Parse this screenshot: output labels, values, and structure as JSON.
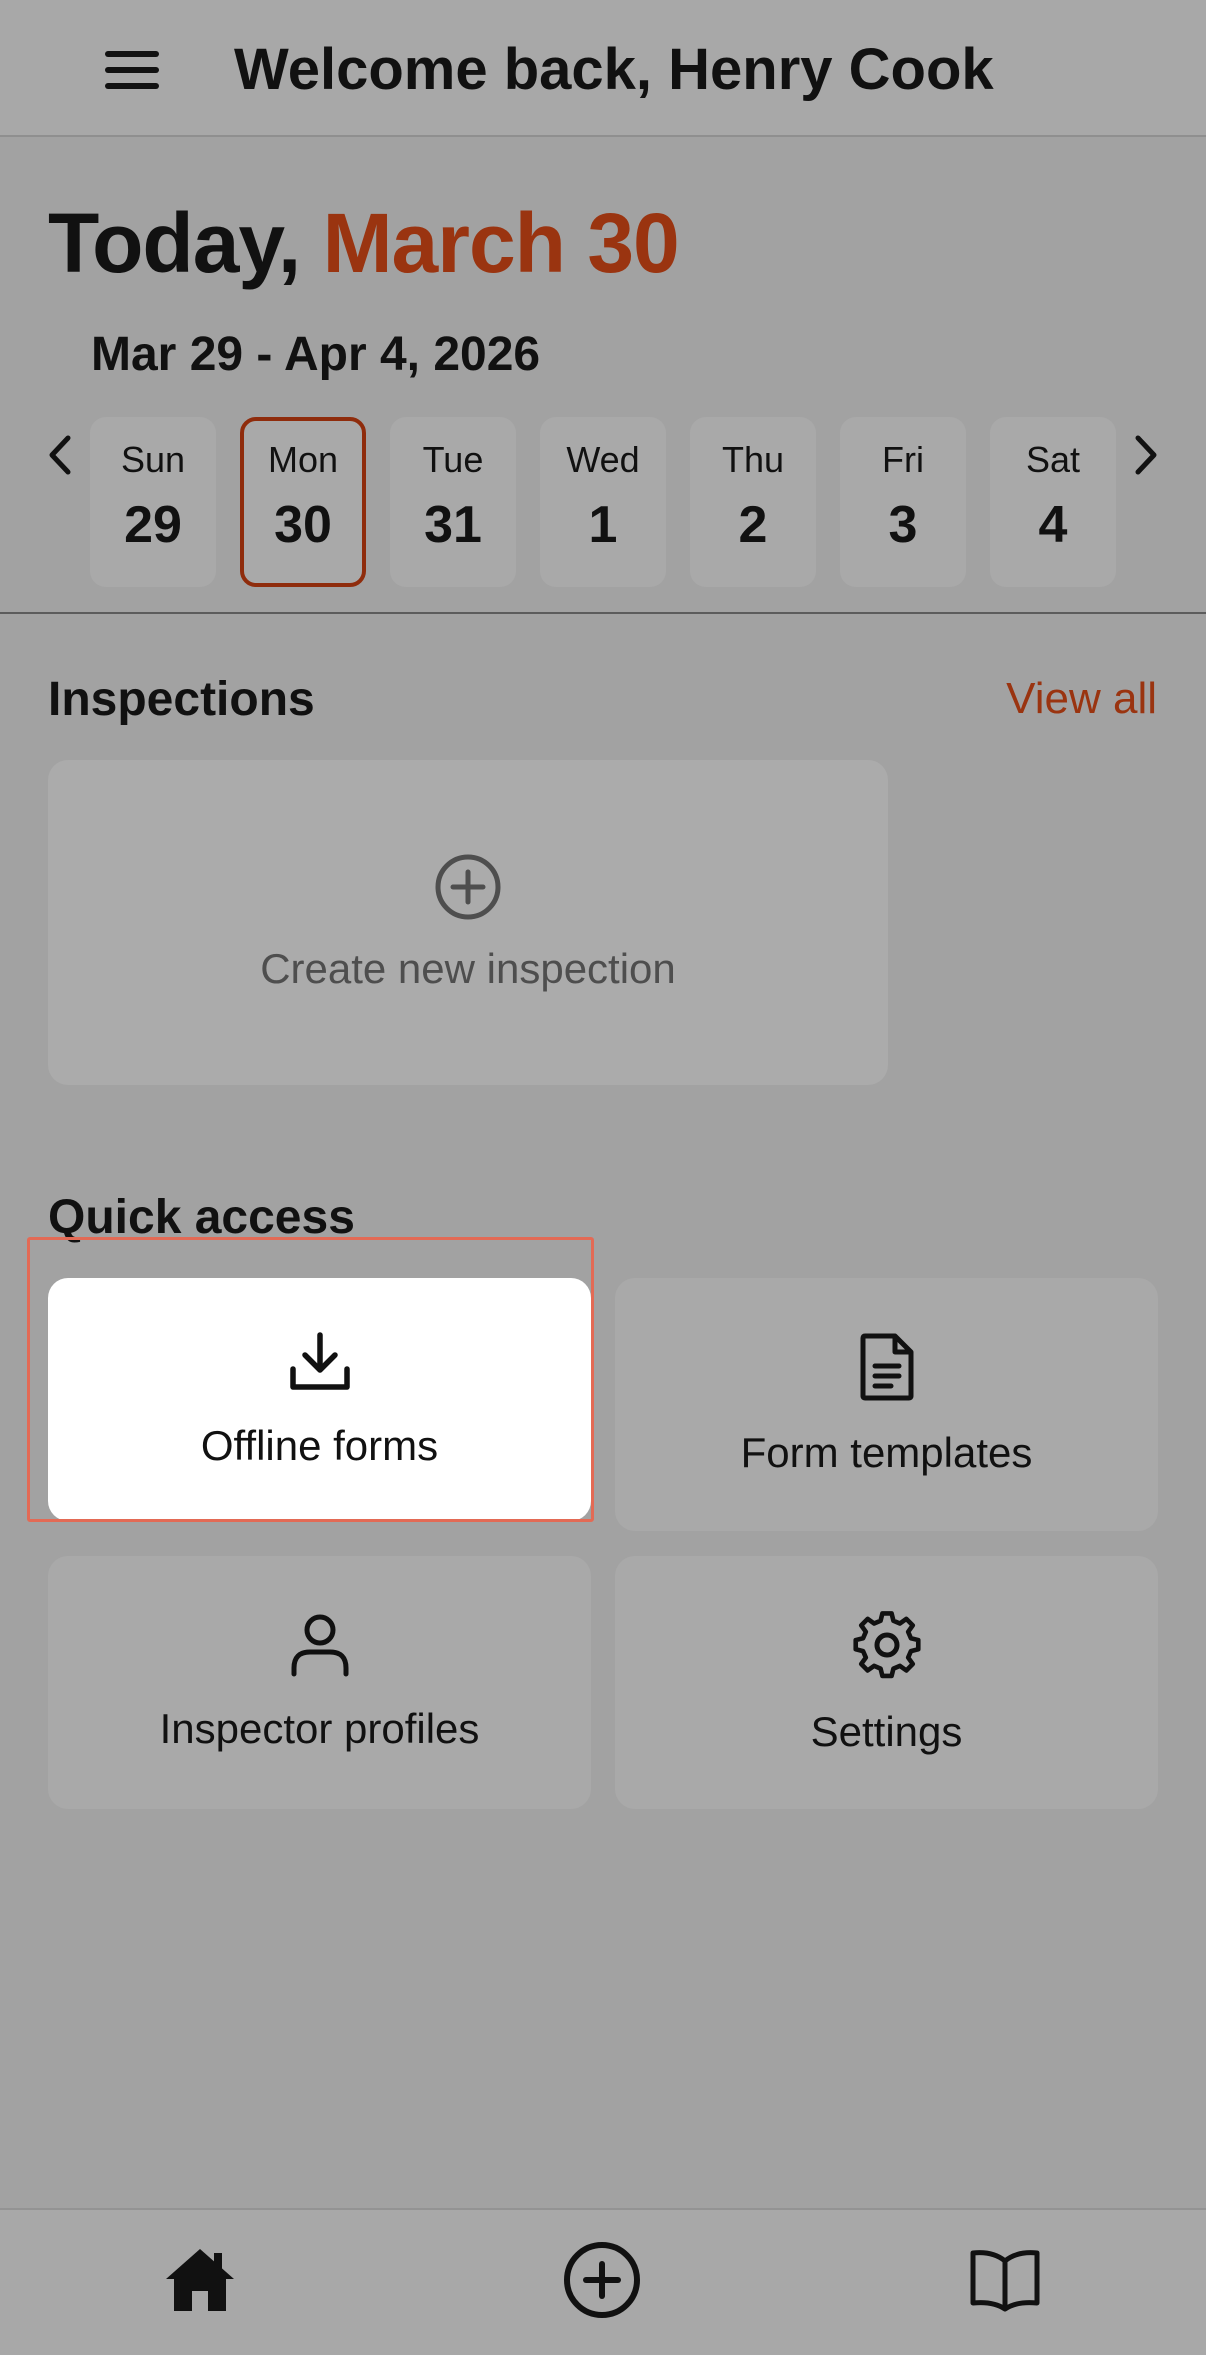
{
  "header": {
    "title": "Welcome back, Henry Cook",
    "menu_icon": "hamburger-menu-icon"
  },
  "today": {
    "prefix": "Today,",
    "date": "March 30"
  },
  "week": {
    "range": "Mar 29 - Apr 4, 2026",
    "days": [
      {
        "name": "Sun",
        "num": "29"
      },
      {
        "name": "Mon",
        "num": "30",
        "selected": true
      },
      {
        "name": "Tue",
        "num": "31"
      },
      {
        "name": "Wed",
        "num": "1"
      },
      {
        "name": "Thu",
        "num": "2"
      },
      {
        "name": "Fri",
        "num": "3"
      },
      {
        "name": "Sat",
        "num": "4"
      }
    ]
  },
  "inspections": {
    "title": "Inspections",
    "view_all": "View all",
    "create_label": "Create new inspection"
  },
  "quick_access": {
    "title": "Quick access",
    "tiles": [
      {
        "label": "Offline forms",
        "icon": "download-icon"
      },
      {
        "label": "Form templates",
        "icon": "document-icon"
      },
      {
        "label": "Inspector profiles",
        "icon": "user-icon"
      },
      {
        "label": "Settings",
        "icon": "gear-icon"
      }
    ]
  },
  "colors": {
    "accent": "#9a3410",
    "selected_border": "#8f2c0c",
    "highlight": "#e36a55"
  },
  "bottom_nav": {
    "icons": [
      "home-icon",
      "add-circle-icon",
      "book-icon"
    ]
  }
}
